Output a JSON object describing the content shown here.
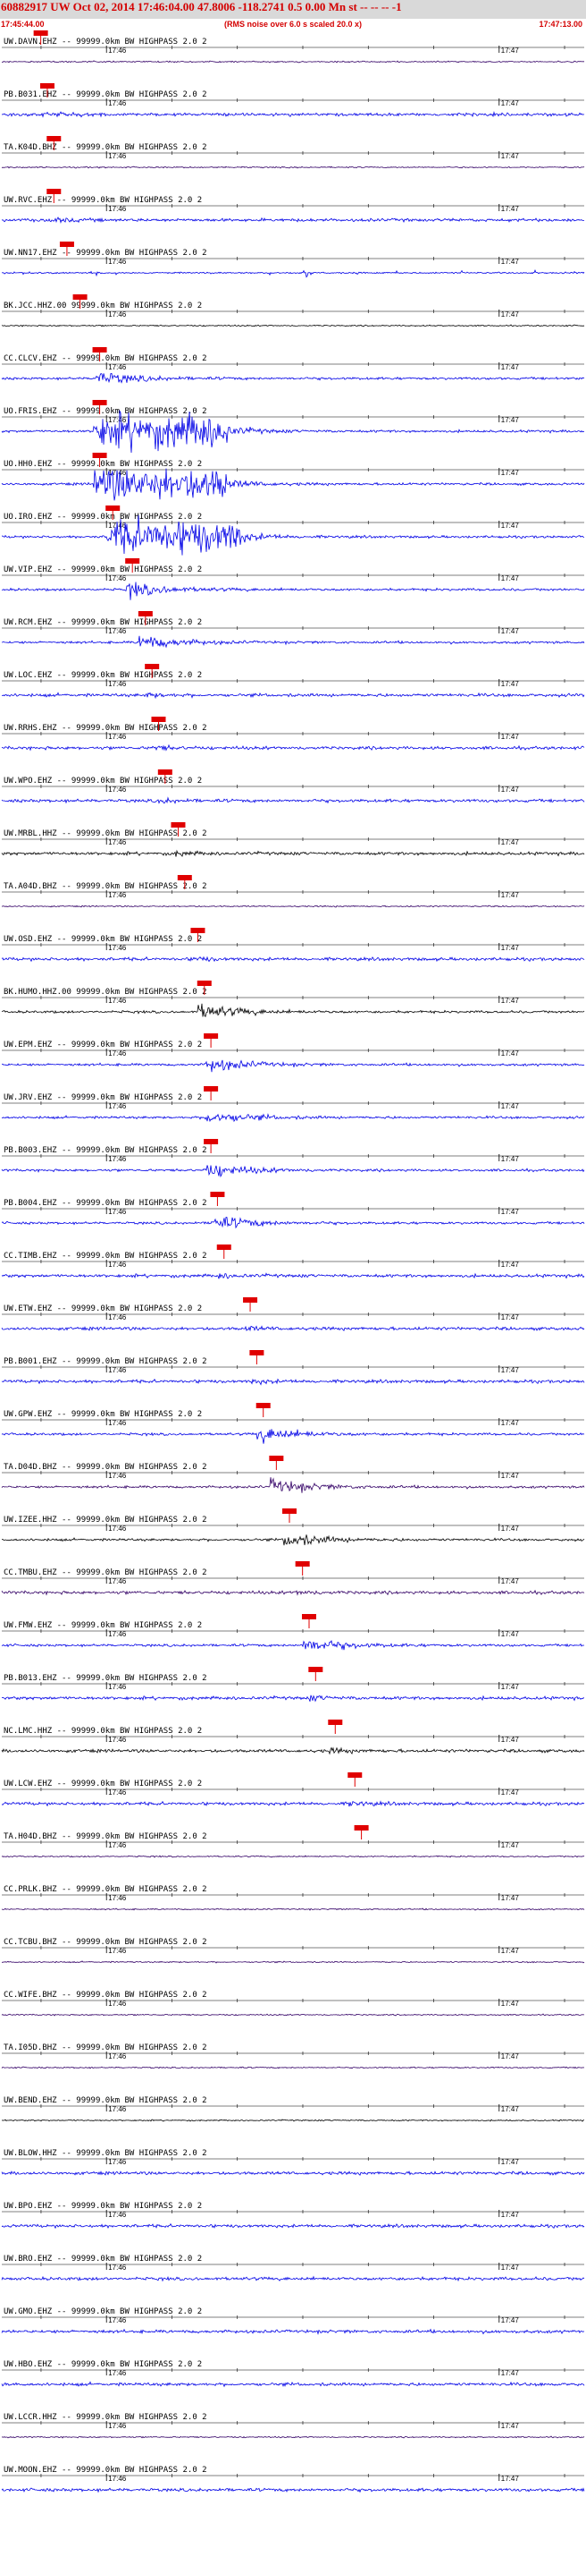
{
  "header": {
    "title": "60882917 UW Oct 02, 2014 17:46:04.00   47.8006 -118.2741  0.5 0.00 Mn st -- -- -- -1",
    "start_time": "17:45:44.00",
    "note": "(RMS noise over 6.0 s scaled 20.0 x)",
    "end_time": "17:47:13.00"
  },
  "colors": {
    "background": "#ffffff",
    "header_band": "#d9d9d9",
    "header_text": "#d40000",
    "pick_marker": "#e00000",
    "trace_blue": "#0000e6",
    "trace_dark_purple": "#330066",
    "trace_black": "#000000"
  },
  "chart_data": {
    "type": "seismogram",
    "x_range": [
      "17:45:44.00",
      "17:47:13.00"
    ],
    "minor_tick_labels": [
      "17:46",
      "17:47"
    ],
    "stations": [
      {
        "label": "UW.DAVN.EHZ -- 99999.0km BW  HIGHPASS  2.0  2",
        "color": "dark_purple",
        "activity": "quiet",
        "pick": "17:45:49"
      },
      {
        "label": "PB.B031.EHZ -- 99999.0km BW  HIGHPASS  2.0  2",
        "color": "blue",
        "activity": "noisy",
        "pick": "17:45:50"
      },
      {
        "label": "TA.K04D.BHZ -- 99999.0km BW  HIGHPASS  2.0  2",
        "color": "dark_purple",
        "activity": "quiet",
        "pick": "17:45:51"
      },
      {
        "label": "UW.RVC.EHZ -- 99999.0km BW  HIGHPASS  2.0  2",
        "color": "blue",
        "activity": "noisy",
        "pick": "17:45:51"
      },
      {
        "label": "UW.NN17.EHZ -- 99999.0km BW  HIGHPASS  2.0  2",
        "color": "blue",
        "activity": "spiky",
        "pick": "17:45:53"
      },
      {
        "label": "BK.JCC.HHZ.00 99999.0km BW  HIGHPASS  2.0  2",
        "color": "black",
        "activity": "quiet",
        "pick": "17:45:55"
      },
      {
        "label": "CC.CLCV.EHZ -- 99999.0km BW  HIGHPASS  2.0  2",
        "color": "blue",
        "activity": "burst",
        "pick": "17:45:58"
      },
      {
        "label": "UO.FRIS.EHZ -- 99999.0km BW  HIGHPASS  2.0  2",
        "color": "blue",
        "activity": "saturated",
        "pick": "17:45:58"
      },
      {
        "label": "UO.HH0.EHZ -- 99999.0km BW  HIGHPASS  2.0  2",
        "color": "blue",
        "activity": "saturated",
        "pick": "17:45:58"
      },
      {
        "label": "UO.IRO.EHZ -- 99999.0km BW  HIGHPASS  2.0  2",
        "color": "blue",
        "activity": "saturated",
        "pick": "17:46:00"
      },
      {
        "label": "UW.VIP.EHZ -- 99999.0km BW  HIGHPASS  2.0  2",
        "color": "blue",
        "activity": "burst",
        "pick": "17:46:03"
      },
      {
        "label": "UW.RCM.EHZ -- 99999.0km BW  HIGHPASS  2.0  2",
        "color": "blue",
        "activity": "burst",
        "pick": "17:46:05"
      },
      {
        "label": "UW.LOC.EHZ -- 99999.0km BW  HIGHPASS  2.0  2",
        "color": "blue",
        "activity": "noisy",
        "pick": "17:46:06"
      },
      {
        "label": "UW.RRHS.EHZ -- 99999.0km BW  HIGHPASS  2.0  2",
        "color": "blue",
        "activity": "noisy",
        "pick": "17:46:07"
      },
      {
        "label": "UW.WPO.EHZ -- 99999.0km BW  HIGHPASS  2.0  2",
        "color": "blue",
        "activity": "noisy",
        "pick": "17:46:08"
      },
      {
        "label": "UW.MRBL.HHZ -- 99999.0km BW  HIGHPASS  2.0  2",
        "color": "black",
        "activity": "noisy",
        "pick": "17:46:10"
      },
      {
        "label": "TA.A04D.BHZ -- 99999.0km BW  HIGHPASS  2.0  2",
        "color": "dark_purple",
        "activity": "quiet",
        "pick": "17:46:11"
      },
      {
        "label": "UW.OSD.EHZ -- 99999.0km BW  HIGHPASS  2.0  2",
        "color": "blue",
        "activity": "noisy",
        "pick": "17:46:13"
      },
      {
        "label": "BK.HUMO.HHZ.00 99999.0km BW  HIGHPASS  2.0  2",
        "color": "black",
        "activity": "burst",
        "pick": "17:46:14"
      },
      {
        "label": "UW.EPM.EHZ -- 99999.0km BW  HIGHPASS  2.0  2",
        "color": "blue",
        "activity": "burst",
        "pick": "17:46:15"
      },
      {
        "label": "UW.JRV.EHZ -- 99999.0km BW  HIGHPASS  2.0  2",
        "color": "blue",
        "activity": "burst",
        "pick": "17:46:15"
      },
      {
        "label": "PB.B003.EHZ -- 99999.0km BW  HIGHPASS  2.0  2",
        "color": "blue",
        "activity": "burst",
        "pick": "17:46:15"
      },
      {
        "label": "PB.B004.EHZ -- 99999.0km BW  HIGHPASS  2.0  2",
        "color": "blue",
        "activity": "burst",
        "pick": "17:46:16"
      },
      {
        "label": "CC.TIMB.EHZ -- 99999.0km BW  HIGHPASS  2.0  2",
        "color": "blue",
        "activity": "noisy",
        "pick": "17:46:17"
      },
      {
        "label": "UW.ETW.EHZ -- 99999.0km BW  HIGHPASS  2.0  2",
        "color": "blue",
        "activity": "noisy",
        "pick": "17:46:21"
      },
      {
        "label": "PB.B001.EHZ -- 99999.0km BW  HIGHPASS  2.0  2",
        "color": "blue",
        "activity": "noisy",
        "pick": "17:46:22"
      },
      {
        "label": "UW.GPW.EHZ -- 99999.0km BW  HIGHPASS  2.0  2",
        "color": "blue",
        "activity": "burst",
        "pick": "17:46:23"
      },
      {
        "label": "TA.D04D.BHZ -- 99999.0km BW  HIGHPASS  2.0  2",
        "color": "dark_purple",
        "activity": "burst",
        "pick": "17:46:25"
      },
      {
        "label": "UW.IZEE.HHZ -- 99999.0km BW  HIGHPASS  2.0  2",
        "color": "black",
        "activity": "burst",
        "pick": "17:46:27"
      },
      {
        "label": "CC.TMBU.EHZ -- 99999.0km BW  HIGHPASS  2.0  2",
        "color": "dark_purple",
        "activity": "noisy",
        "pick": "17:46:29"
      },
      {
        "label": "UW.FMW.EHZ -- 99999.0km BW  HIGHPASS  2.0  2",
        "color": "blue",
        "activity": "burst",
        "pick": "17:46:30"
      },
      {
        "label": "PB.B013.EHZ -- 99999.0km BW  HIGHPASS  2.0  2",
        "color": "blue",
        "activity": "noisy",
        "pick": "17:46:31"
      },
      {
        "label": "NC.LMC.HHZ -- 99999.0km BW  HIGHPASS  2.0  2",
        "color": "black",
        "activity": "noisy",
        "pick": "17:46:34"
      },
      {
        "label": "UW.LCW.EHZ -- 99999.0km BW  HIGHPASS  2.0  2",
        "color": "blue",
        "activity": "noisy",
        "pick": "17:46:37"
      },
      {
        "label": "TA.H04D.BHZ -- 99999.0km BW  HIGHPASS  2.0  2",
        "color": "dark_purple",
        "activity": "quiet",
        "pick": "17:46:38"
      },
      {
        "label": "CC.PRLK.BHZ -- 99999.0km BW  HIGHPASS  2.0  2",
        "color": "dark_purple",
        "activity": "quiet",
        "pick": ""
      },
      {
        "label": "CC.TCBU.BHZ -- 99999.0km BW  HIGHPASS  2.0  2",
        "color": "dark_purple",
        "activity": "quiet",
        "pick": ""
      },
      {
        "label": "CC.WIFE.BHZ -- 99999.0km BW  HIGHPASS  2.0  2",
        "color": "dark_purple",
        "activity": "quiet",
        "pick": ""
      },
      {
        "label": "TA.I05D.BHZ -- 99999.0km BW  HIGHPASS  2.0  2",
        "color": "dark_purple",
        "activity": "quiet",
        "pick": ""
      },
      {
        "label": "UW.BEND.EHZ -- 99999.0km BW  HIGHPASS  2.0  2",
        "color": "black",
        "activity": "quiet",
        "pick": ""
      },
      {
        "label": "UW.BLOW.HHZ -- 99999.0km BW  HIGHPASS  2.0  2",
        "color": "blue",
        "activity": "noisy",
        "pick": ""
      },
      {
        "label": "UW.BPO.EHZ -- 99999.0km BW  HIGHPASS  2.0  2",
        "color": "blue",
        "activity": "noisy",
        "pick": ""
      },
      {
        "label": "UW.BRO.EHZ -- 99999.0km BW  HIGHPASS  2.0  2",
        "color": "blue",
        "activity": "noisy",
        "pick": ""
      },
      {
        "label": "UW.GMO.EHZ -- 99999.0km BW  HIGHPASS  2.0  2",
        "color": "blue",
        "activity": "noisy",
        "pick": ""
      },
      {
        "label": "UW.HBO.EHZ -- 99999.0km BW  HIGHPASS  2.0  2",
        "color": "blue",
        "activity": "noisy",
        "pick": ""
      },
      {
        "label": "UW.LCCR.HHZ -- 99999.0km BW  HIGHPASS  2.0  2",
        "color": "dark_purple",
        "activity": "quiet",
        "pick": ""
      },
      {
        "label": "UW.MOON.EHZ -- 99999.0km BW  HIGHPASS  2.0  2",
        "color": "blue",
        "activity": "noisy",
        "pick": ""
      }
    ]
  }
}
